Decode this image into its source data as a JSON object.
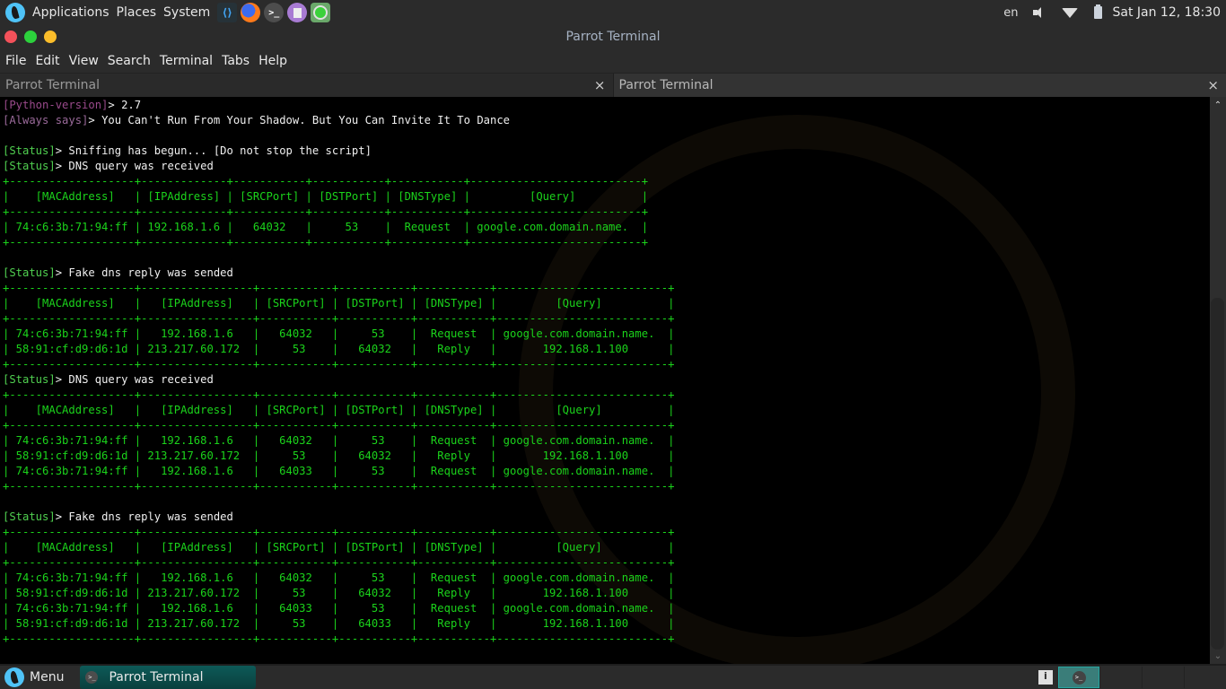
{
  "top_panel": {
    "menus": [
      "Applications",
      "Places",
      "System"
    ],
    "launchers": [
      {
        "name": "vscode-icon",
        "glyph": "⟨⟩"
      },
      {
        "name": "firefox-icon",
        "glyph": ""
      },
      {
        "name": "terminal-icon",
        "glyph": ">_"
      },
      {
        "name": "text-editor-icon",
        "glyph": ""
      },
      {
        "name": "network-icon",
        "glyph": ""
      }
    ],
    "keyboard_layout": "en",
    "clock": "Sat Jan 12, 18:30"
  },
  "window": {
    "title": "Parrot Terminal",
    "menu": [
      "File",
      "Edit",
      "View",
      "Search",
      "Terminal",
      "Tabs",
      "Help"
    ],
    "tabs": [
      {
        "label": "Parrot Terminal",
        "close": "×",
        "active": false
      },
      {
        "label": "Parrot Terminal",
        "close": "×",
        "active": true
      }
    ]
  },
  "terminal": {
    "python_version": {
      "prefix": "[Python-version]",
      "arrow": "> ",
      "value": "2.7"
    },
    "always_says": {
      "prefix": "[Always says]",
      "arrow": "> ",
      "value": "You Can't Run From Your Shadow. But You Can Invite It To Dance"
    },
    "blocks": [
      {
        "status_lines": [
          {
            "prefix": "[Status]",
            "arrow": "> ",
            "text": "Sniffing has begun... [Do not stop the script]"
          },
          {
            "prefix": "[Status]",
            "arrow": "> ",
            "text": "DNS query was received"
          }
        ],
        "table": [
          "+-------------------+-------------+-----------+-----------+-----------+--------------------------+",
          "|    [MACAddress]   | [IPAddress] | [SRCPort] | [DSTPort] | [DNSType] |         [Query]          |",
          "+-------------------+-------------+-----------+-----------+-----------+--------------------------+",
          "| 74:c6:3b:71:94:ff | 192.168.1.6 |   64032   |     53    |  Request  | google.com.domain.name.  |",
          "+-------------------+-------------+-----------+-----------+-----------+--------------------------+"
        ],
        "blank_after": 1
      },
      {
        "status_lines": [
          {
            "prefix": "[Status]",
            "arrow": "> ",
            "text": "Fake dns reply was sended"
          }
        ],
        "table": [
          "+-------------------+-----------------+-----------+-----------+-----------+--------------------------+",
          "|    [MACAddress]   |   [IPAddress]   | [SRCPort] | [DSTPort] | [DNSType] |         [Query]          |",
          "+-------------------+-----------------+-----------+-----------+-----------+--------------------------+",
          "| 74:c6:3b:71:94:ff |   192.168.1.6   |   64032   |     53    |  Request  | google.com.domain.name.  |",
          "| 58:91:cf:d9:d6:1d | 213.217.60.172  |     53    |   64032   |   Reply   |       192.168.1.100      |",
          "+-------------------+-----------------+-----------+-----------+-----------+--------------------------+"
        ],
        "blank_after": 0
      },
      {
        "status_lines": [
          {
            "prefix": "[Status]",
            "arrow": "> ",
            "text": "DNS query was received"
          }
        ],
        "table": [
          "+-------------------+-----------------+-----------+-----------+-----------+--------------------------+",
          "|    [MACAddress]   |   [IPAddress]   | [SRCPort] | [DSTPort] | [DNSType] |         [Query]          |",
          "+-------------------+-----------------+-----------+-----------+-----------+--------------------------+",
          "| 74:c6:3b:71:94:ff |   192.168.1.6   |   64032   |     53    |  Request  | google.com.domain.name.  |",
          "| 58:91:cf:d9:d6:1d | 213.217.60.172  |     53    |   64032   |   Reply   |       192.168.1.100      |",
          "| 74:c6:3b:71:94:ff |   192.168.1.6   |   64033   |     53    |  Request  | google.com.domain.name.  |",
          "+-------------------+-----------------+-----------+-----------+-----------+--------------------------+"
        ],
        "blank_after": 1
      },
      {
        "status_lines": [
          {
            "prefix": "[Status]",
            "arrow": "> ",
            "text": "Fake dns reply was sended"
          }
        ],
        "table": [
          "+-------------------+-----------------+-----------+-----------+-----------+--------------------------+",
          "|    [MACAddress]   |   [IPAddress]   | [SRCPort] | [DSTPort] | [DNSType] |         [Query]          |",
          "+-------------------+-----------------+-----------+-----------+-----------+--------------------------+",
          "| 74:c6:3b:71:94:ff |   192.168.1.6   |   64032   |     53    |  Request  | google.com.domain.name.  |",
          "| 58:91:cf:d9:d6:1d | 213.217.60.172  |     53    |   64032   |   Reply   |       192.168.1.100      |",
          "| 74:c6:3b:71:94:ff |   192.168.1.6   |   64033   |     53    |  Request  | google.com.domain.name.  |",
          "| 58:91:cf:d9:d6:1d | 213.217.60.172  |     53    |   64033   |   Reply   |       192.168.1.100      |",
          "+-------------------+-----------------+-----------+-----------+-----------+--------------------------+"
        ],
        "blank_after": 0
      }
    ]
  },
  "scrollbar": {
    "up": "⌃",
    "down": "⌄"
  },
  "bottom_panel": {
    "menu_label": "Menu",
    "task_label": "Parrot Terminal",
    "task_icon_glyph": ">_",
    "workspace_icon_glyph": ">_"
  },
  "colors": {
    "table_green": "#1bd31b",
    "status_green": "#50d050",
    "prefix_purple": "#9a4a8c",
    "panel_bg": "#2b2b2b",
    "task_teal": "#0d5a58"
  }
}
